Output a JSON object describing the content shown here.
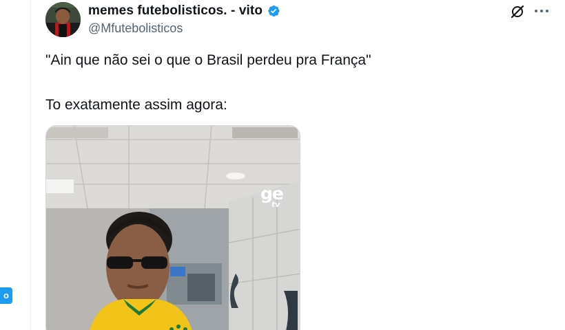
{
  "tweet": {
    "author": {
      "display_name": "memes futebolisticos. - vito",
      "handle": "@Mfutebolisticos",
      "verified": true,
      "avatar": "avatar-image"
    },
    "text_line1": "\"Ain que não sei o que o Brasil perdeu pra França\"",
    "text_line2": "To exatamente assim agora:",
    "media": {
      "type": "video-frame",
      "watermark": "ge",
      "watermark_sub": "tv"
    },
    "actions": {
      "grok_icon": "grok-icon",
      "more_icon": "more-icon"
    }
  },
  "left_edge": {
    "badge_text": "o"
  },
  "colors": {
    "accent": "#1d9bf0",
    "text": "#0f1419",
    "secondary": "#536471",
    "divider": "#eff3f4"
  }
}
